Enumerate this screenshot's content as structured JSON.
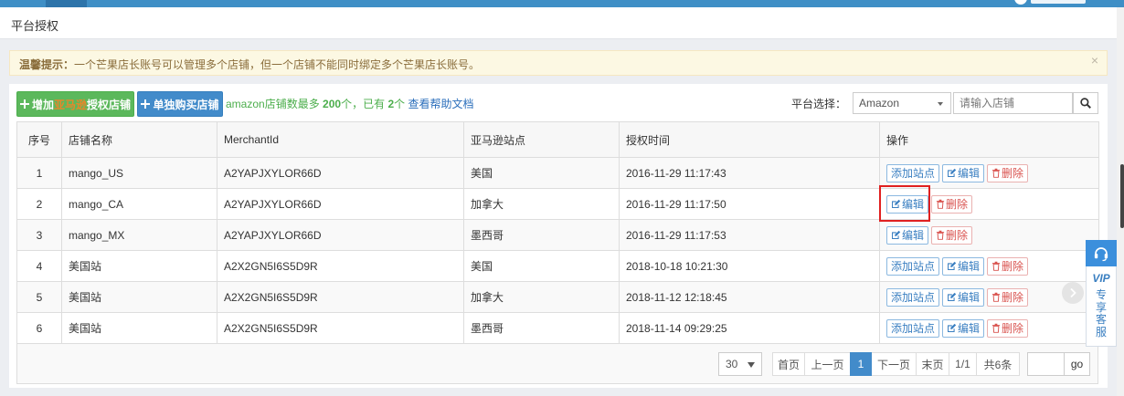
{
  "breadcrumb": {
    "title": "平台授权"
  },
  "alert": {
    "label": "温馨提示：",
    "message": "一个芒果店长账号可以管理多个店铺，但一个店铺不能同时绑定多个芒果店长账号。",
    "close": "×"
  },
  "toolbar": {
    "add_store": {
      "prefix": "增加",
      "highlight": "亚马逊",
      "suffix": "授权店铺"
    },
    "buy_store": "单独购买店铺",
    "quota": {
      "label": "amazon店铺数最多",
      "max": "200",
      "unit1": "个，已有",
      "count": "2",
      "unit2": "个",
      "help_link": "查看帮助文档"
    },
    "platform_label": "平台选择：",
    "platform_selected": "Amazon",
    "store_search_placeholder": "请输入店铺"
  },
  "table": {
    "columns": {
      "index": "序号",
      "name": "店铺名称",
      "merchant_id": "MerchantId",
      "site": "亚马逊站点",
      "auth_time": "授权时间",
      "actions": "操作"
    },
    "rows": [
      {
        "index": "1",
        "name": "mango_US",
        "merchant_id": "A2YAPJXYLOR66D",
        "site": "美国",
        "auth_time": "2016-11-29 11:17:43",
        "actions": [
          "添加站点",
          "编辑",
          "删除"
        ]
      },
      {
        "index": "2",
        "name": "mango_CA",
        "merchant_id": "A2YAPJXYLOR66D",
        "site": "加拿大",
        "auth_time": "2016-11-29 11:17:50",
        "actions": [
          "编辑",
          "删除"
        ]
      },
      {
        "index": "3",
        "name": "mango_MX",
        "merchant_id": "A2YAPJXYLOR66D",
        "site": "墨西哥",
        "auth_time": "2016-11-29 11:17:53",
        "actions": [
          "编辑",
          "删除"
        ]
      },
      {
        "index": "4",
        "name": "美国站",
        "merchant_id": "A2X2GN5I6S5D9R",
        "site": "美国",
        "auth_time": "2018-10-18 10:21:30",
        "actions": [
          "添加站点",
          "编辑",
          "删除"
        ]
      },
      {
        "index": "5",
        "name": "美国站",
        "merchant_id": "A2X2GN5I6S5D9R",
        "site": "加拿大",
        "auth_time": "2018-11-12 12:18:45",
        "actions": [
          "添加站点",
          "编辑",
          "删除"
        ]
      },
      {
        "index": "6",
        "name": "美国站",
        "merchant_id": "A2X2GN5I6S5D9R",
        "site": "墨西哥",
        "auth_time": "2018-11-14 09:29:25",
        "actions": [
          "添加站点",
          "编辑",
          "删除"
        ]
      }
    ]
  },
  "pagination": {
    "page_size": "30",
    "first": "首页",
    "prev": "上一页",
    "current": "1",
    "next": "下一页",
    "last": "末页",
    "page_info": "1/1",
    "total": "共6条",
    "go": "go"
  },
  "service": {
    "vip": "VIP",
    "label": "专享客服"
  },
  "icons": [
    "plus-icon",
    "search-icon",
    "edit-icon",
    "trash-icon",
    "headset-icon",
    "chevron-right-icon",
    "caret-down-icon"
  ],
  "colors": {
    "brand_bar": "#3f8fc6",
    "success": "#5cb85c",
    "primary": "#428bca",
    "danger": "#d9534f",
    "alert_bg": "#fcf8e3",
    "annotation": "#e02020"
  }
}
